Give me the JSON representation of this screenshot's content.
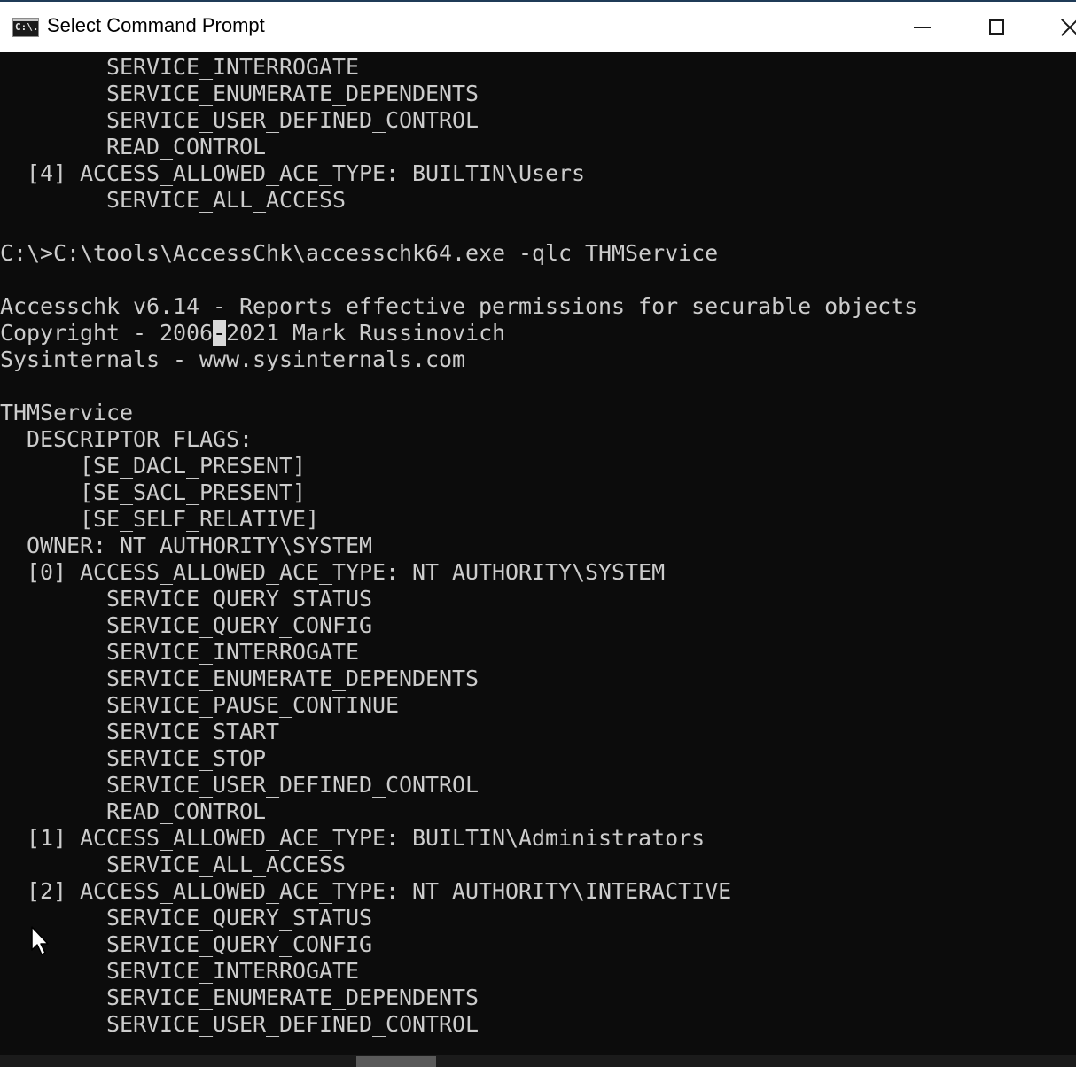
{
  "window": {
    "title": "Select Command Prompt",
    "icon_name": "cmd-icon",
    "icon_text": "C:\\."
  },
  "controls": {
    "minimize_icon": "minimize-icon",
    "maximize_icon": "maximize-icon",
    "close_icon": "close-icon"
  },
  "console": {
    "lines": [
      "        SERVICE_INTERROGATE",
      "        SERVICE_ENUMERATE_DEPENDENTS",
      "        SERVICE_USER_DEFINED_CONTROL",
      "        READ_CONTROL",
      "  [4] ACCESS_ALLOWED_ACE_TYPE: BUILTIN\\Users",
      "        SERVICE_ALL_ACCESS",
      "",
      "C:\\>C:\\tools\\AccessChk\\accesschk64.exe -qlc THMService",
      "",
      "Accesschk v6.14 - Reports effective permissions for securable objects",
      "Copyright - 2006-2021 Mark Russinovich",
      "Sysinternals - www.sysinternals.com",
      "",
      "THMService",
      "  DESCRIPTOR FLAGS:",
      "      [SE_DACL_PRESENT]",
      "      [SE_SACL_PRESENT]",
      "      [SE_SELF_RELATIVE]",
      "  OWNER: NT AUTHORITY\\SYSTEM",
      "  [0] ACCESS_ALLOWED_ACE_TYPE: NT AUTHORITY\\SYSTEM",
      "        SERVICE_QUERY_STATUS",
      "        SERVICE_QUERY_CONFIG",
      "        SERVICE_INTERROGATE",
      "        SERVICE_ENUMERATE_DEPENDENTS",
      "        SERVICE_PAUSE_CONTINUE",
      "        SERVICE_START",
      "        SERVICE_STOP",
      "        SERVICE_USER_DEFINED_CONTROL",
      "        READ_CONTROL",
      "  [1] ACCESS_ALLOWED_ACE_TYPE: BUILTIN\\Administrators",
      "        SERVICE_ALL_ACCESS",
      "  [2] ACCESS_ALLOWED_ACE_TYPE: NT AUTHORITY\\INTERACTIVE",
      "        SERVICE_QUERY_STATUS",
      "        SERVICE_QUERY_CONFIG",
      "        SERVICE_INTERROGATE",
      "        SERVICE_ENUMERATE_DEPENDENTS",
      "        SERVICE_USER_DEFINED_CONTROL"
    ],
    "selection": {
      "line_index": 10,
      "char_index": 16
    },
    "mouse_cursor_icon": "mouse-pointer-icon"
  },
  "colors": {
    "console_background": "#0c0c0c",
    "console_text": "#cccccc",
    "titlebar_background": "#ffffff",
    "accent": "#1f3b57"
  }
}
